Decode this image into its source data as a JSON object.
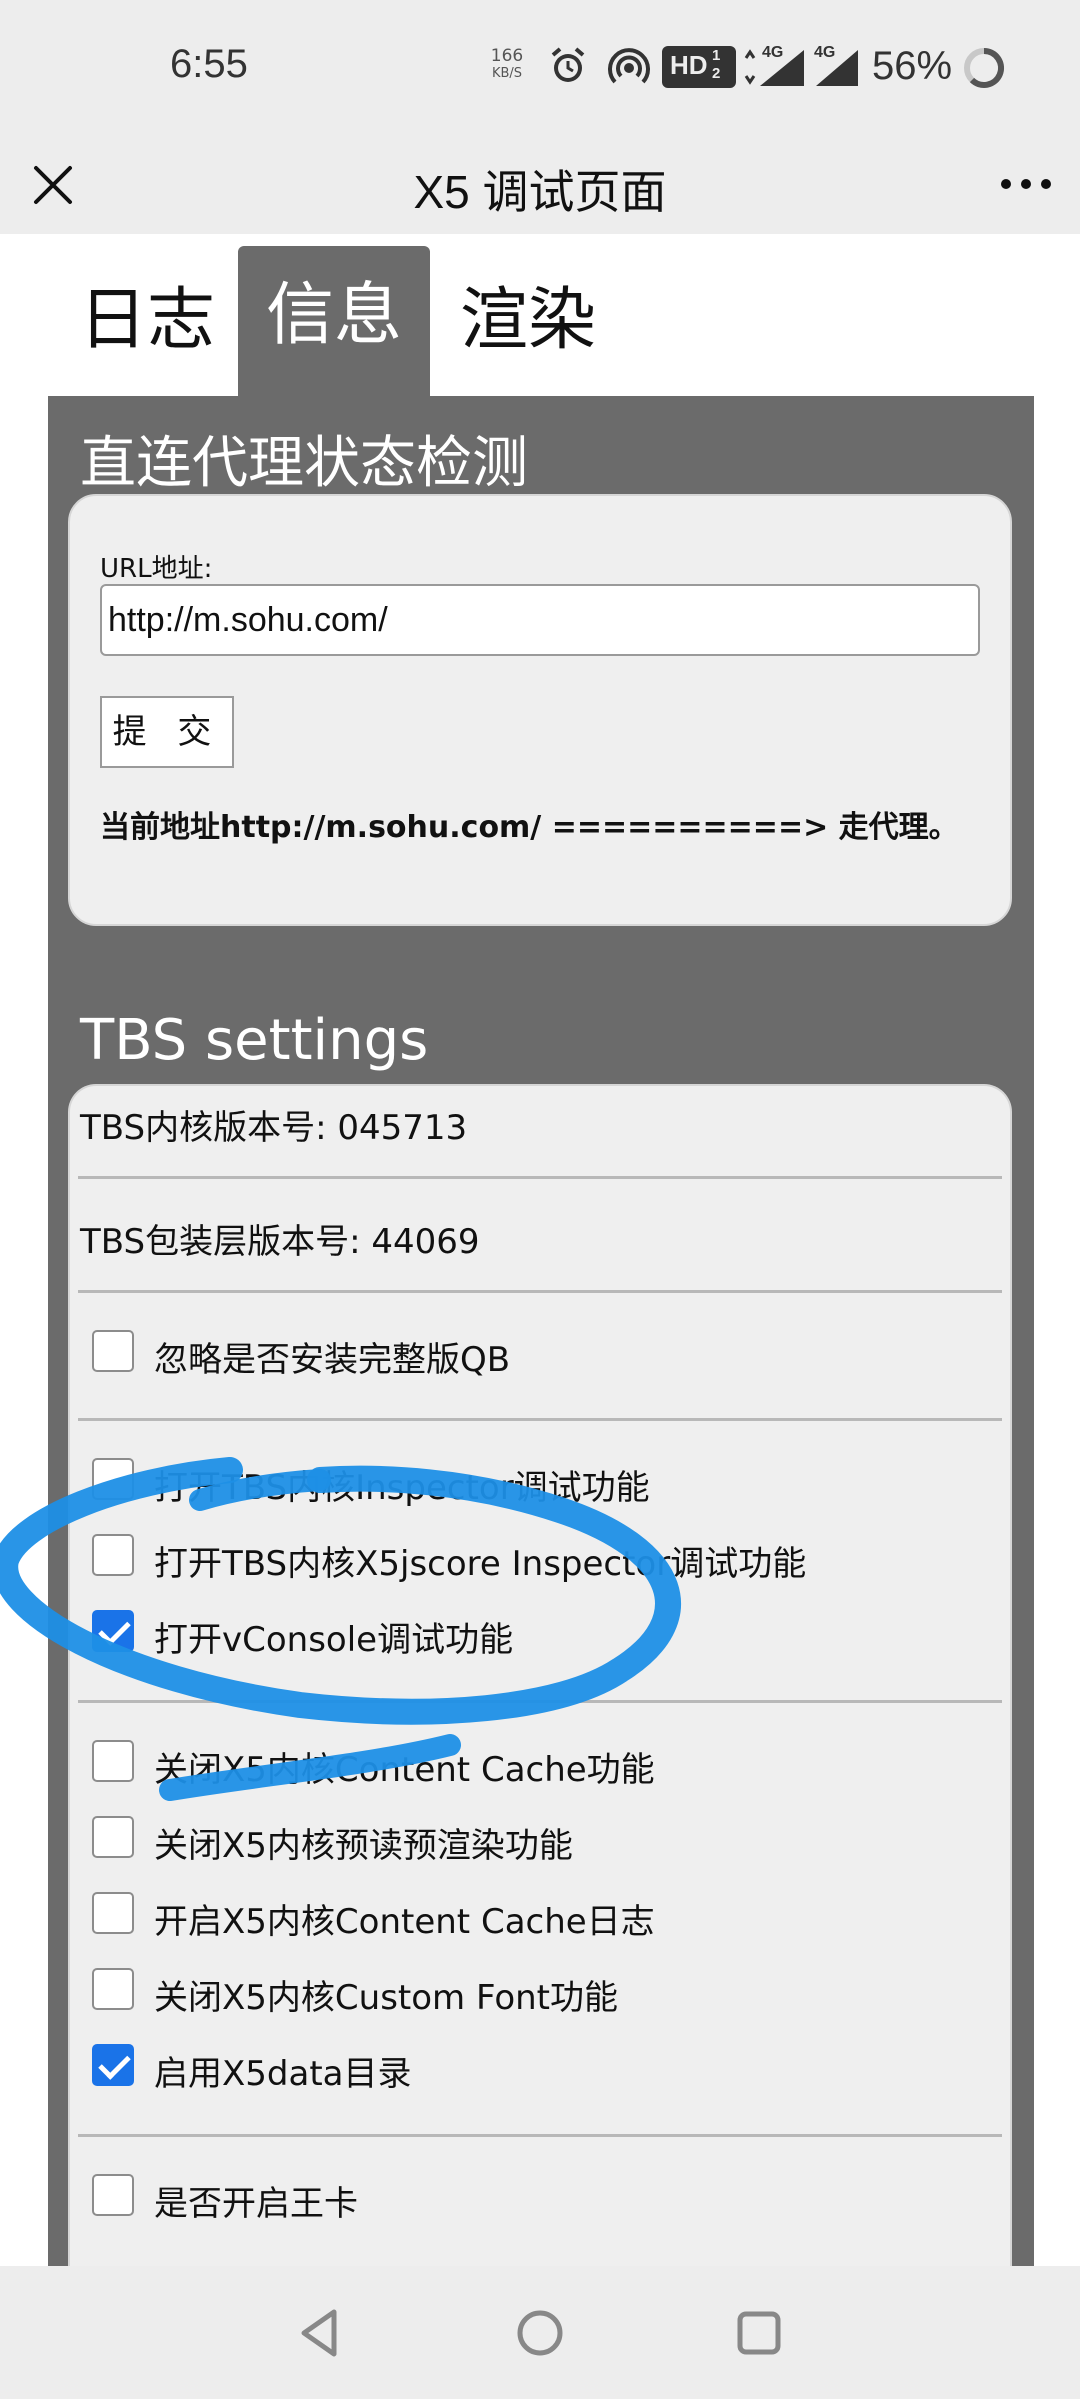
{
  "status_bar": {
    "time": "6:55",
    "net_speed_value": "166",
    "net_speed_unit": "KB/S",
    "hd_badge": "HD",
    "network_1": "4G",
    "network_2": "4G",
    "battery_percent": "56%",
    "icons": [
      "alarm-icon",
      "hotspot-icon",
      "hd-icon",
      "signal-icon",
      "signal-icon",
      "battery-ring-icon"
    ]
  },
  "title_bar": {
    "title": "X5 调试页面",
    "close_icon": "close-icon",
    "more_icon": "more-icon"
  },
  "tabs": [
    {
      "label": "日志",
      "active": false
    },
    {
      "label": "信息",
      "active": true
    },
    {
      "label": "渲染",
      "active": false
    }
  ],
  "proxy_section": {
    "title": "直连代理状态检测",
    "url_label": "URL地址:",
    "url_value": "http://m.sohu.com/",
    "submit_label": "提 交",
    "status_text": "当前地址http://m.sohu.com/ ==========> 走代理。"
  },
  "tbs_section": {
    "title": "TBS settings",
    "core_version": "TBS内核版本号: 045713",
    "sdk_version": "TBS包装层版本号: 44069",
    "groups": [
      [
        {
          "label": "忽略是否安装完整版QB",
          "checked": false
        }
      ],
      [
        {
          "label": "打开TBS内核Inspector调试功能",
          "checked": false
        },
        {
          "label": "打开TBS内核X5jscore Inspector调试功能",
          "checked": false
        },
        {
          "label": "打开vConsole调试功能",
          "checked": true
        }
      ],
      [
        {
          "label": "关闭X5内核Content Cache功能",
          "checked": false
        },
        {
          "label": "关闭X5内核预读预渲染功能",
          "checked": false
        },
        {
          "label": "开启X5内核Content Cache日志",
          "checked": false
        },
        {
          "label": "关闭X5内核Custom Font功能",
          "checked": false
        },
        {
          "label": "启用X5data目录",
          "checked": true
        }
      ],
      [
        {
          "label": "是否开启王卡",
          "checked": false
        }
      ]
    ]
  },
  "annotation": {
    "color": "#1e8fe6"
  },
  "nav_bar": {
    "icons": [
      "back-icon",
      "home-icon",
      "recents-icon"
    ]
  }
}
